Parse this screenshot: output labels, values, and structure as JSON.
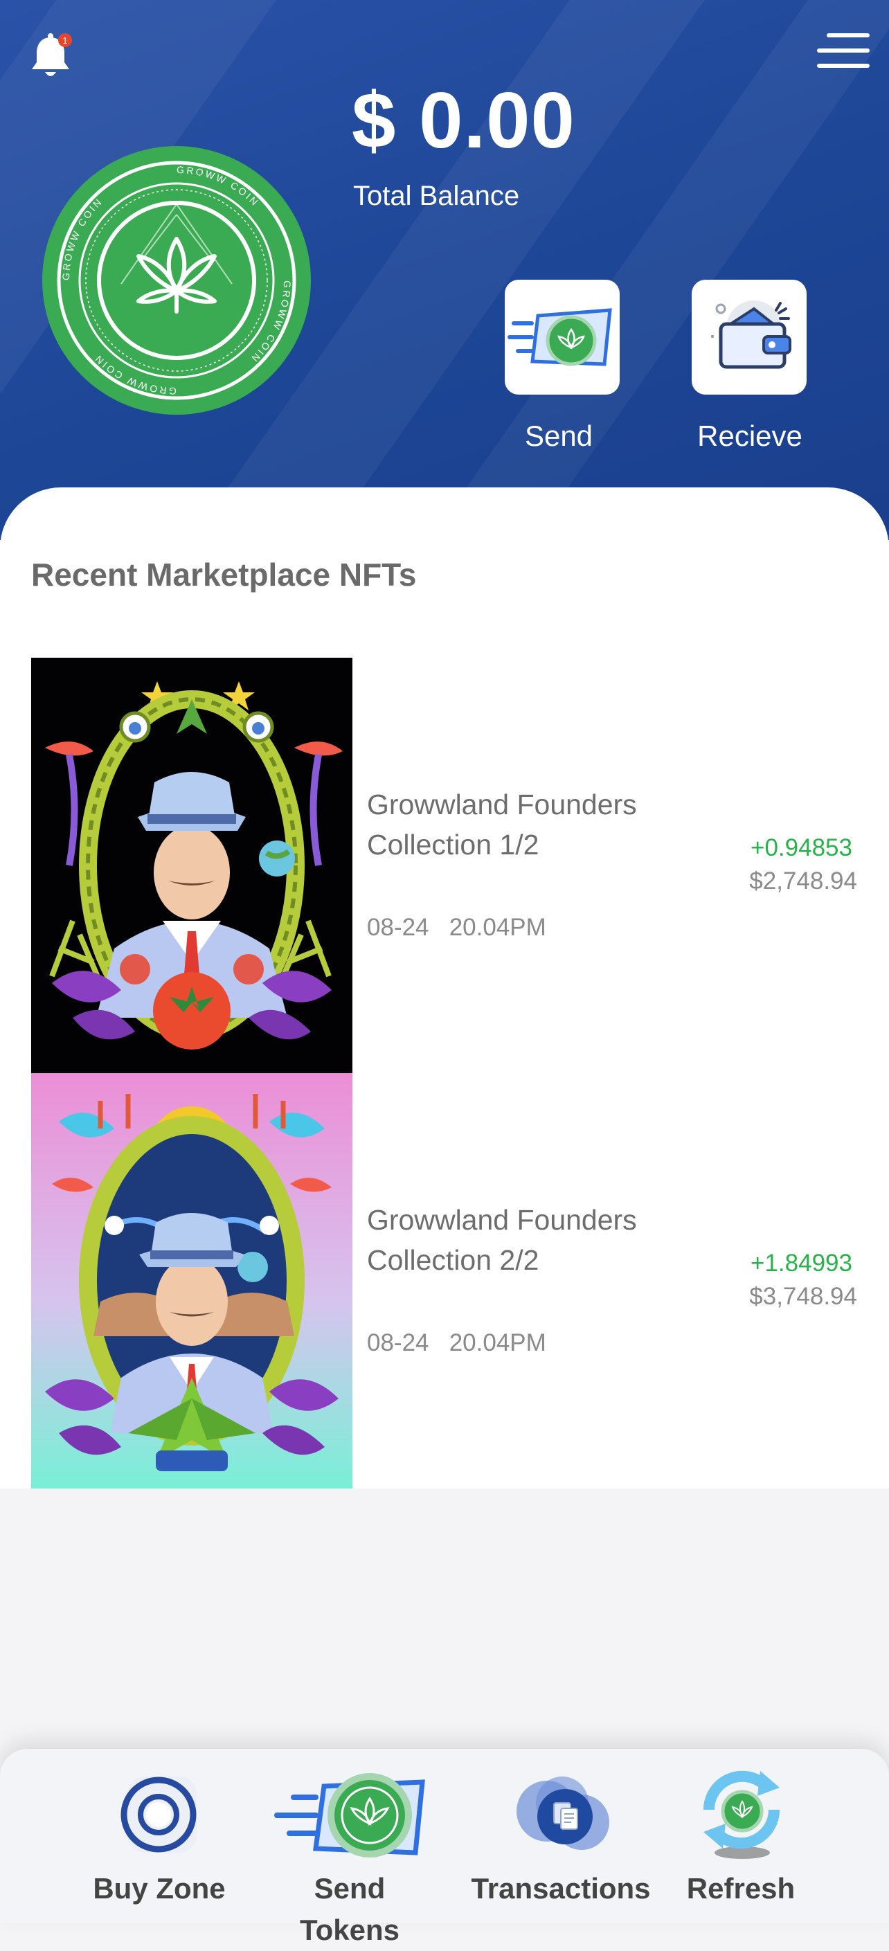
{
  "header": {
    "balance": "$ 0.00",
    "balance_label": "Total Balance",
    "notification_count": "1",
    "coin_text": "GROWW COIN",
    "actions": [
      {
        "label": "Send",
        "icon": "send-coin-icon"
      },
      {
        "label": "Recieve",
        "icon": "wallet-icon"
      }
    ]
  },
  "marketplace": {
    "title": "Recent Marketplace NFTs",
    "items": [
      {
        "title": "Growwland Founders Collection 1/2",
        "date": "08-24",
        "time": "20.04PM",
        "change": "+0.94853",
        "price": "$2,748.94"
      },
      {
        "title": "Growwland Founders Collection 2/2",
        "date": "08-24",
        "time": "20.04PM",
        "change": "+1.84993",
        "price": "$3,748.94"
      }
    ]
  },
  "bottom_nav": [
    {
      "label": "Buy Zone",
      "icon": "target-icon"
    },
    {
      "label": "Send Tokens",
      "icon": "send-coin-icon"
    },
    {
      "label": "Transactions",
      "icon": "documents-icon"
    },
    {
      "label": "Refresh",
      "icon": "refresh-icon"
    }
  ],
  "colors": {
    "header_blue": "#1d4696",
    "coin_green": "#3aab52",
    "positive": "#27b24a"
  }
}
